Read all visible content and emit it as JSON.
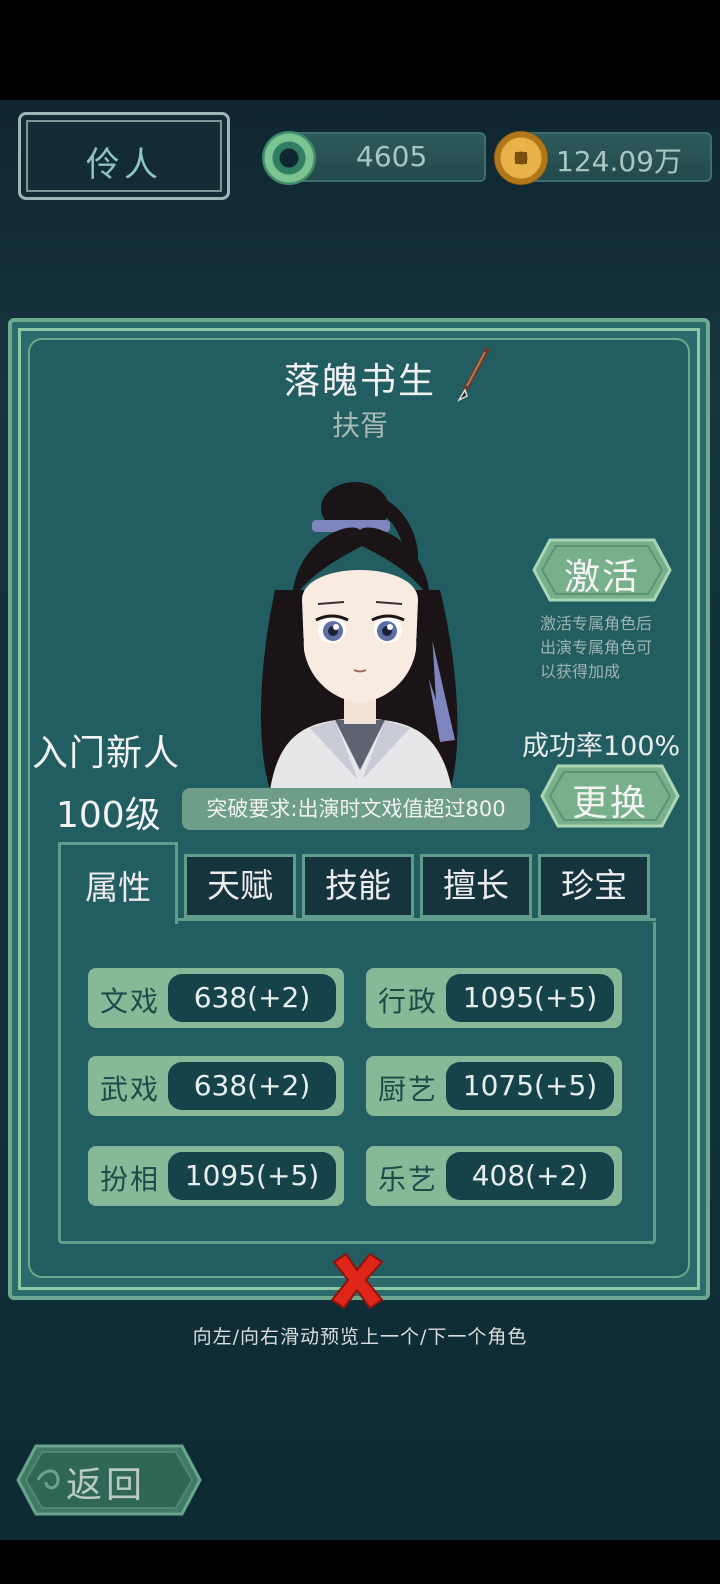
{
  "header": {
    "role_label": "伶人",
    "jade_amount": "4605",
    "coin_amount": "124.09万",
    "jade_icon": "jade-ring-icon",
    "coin_icon": "copper-coin-icon"
  },
  "character": {
    "name": "落魄书生",
    "title": "扶胥",
    "rank": "入门新人",
    "level": "100级",
    "breakthrough_req": "突破要求:出演时文戏值超过800",
    "success_rate": "成功率100%"
  },
  "buttons": {
    "activate": "激活",
    "activate_desc": [
      "激活专属角色后",
      "出演专属角色可",
      "以获得加成"
    ],
    "change": "更换",
    "back": "返回"
  },
  "tabs": [
    "属性",
    "天赋",
    "技能",
    "擅长",
    "珍宝"
  ],
  "active_tab": 0,
  "stats": [
    {
      "label": "文戏",
      "value": "638(+2)"
    },
    {
      "label": "行政",
      "value": "1095(+5)"
    },
    {
      "label": "武戏",
      "value": "638(+2)"
    },
    {
      "label": "厨艺",
      "value": "1075(+5)"
    },
    {
      "label": "扮相",
      "value": "1095(+5)"
    },
    {
      "label": "乐艺",
      "value": "408(+2)"
    }
  ],
  "hint": "向左/向右滑动预览上一个/下一个角色",
  "colors": {
    "panel": "#2b6b6c",
    "panel_border": "#6da98f",
    "stat_bg": "#87b898",
    "value_bg": "#16434a",
    "close": "#e0251b"
  }
}
